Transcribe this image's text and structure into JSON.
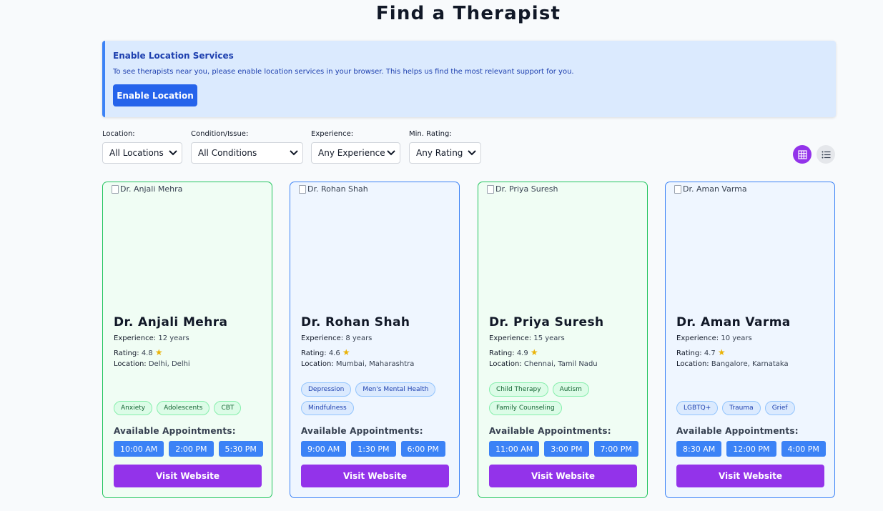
{
  "page": {
    "title": "Find a Therapist"
  },
  "banner": {
    "title": "Enable Location Services",
    "text": "To see therapists near you, please enable location services in your browser. This helps us find the most relevant support for you.",
    "button": "Enable Location"
  },
  "filters": [
    {
      "label": "Location:",
      "value": "All Locations"
    },
    {
      "label": "Condition/Issue:",
      "value": "All Conditions"
    },
    {
      "label": "Experience:",
      "value": "Any Experience"
    },
    {
      "label": "Min. Rating:",
      "value": "Any Rating"
    }
  ],
  "view_toggle": {
    "active": "grid",
    "colors": {
      "active": "#9333ea",
      "inactive": "#e5e7eb"
    }
  },
  "labels": {
    "experience": "Experience:",
    "rating": "Rating:",
    "location": "Location:",
    "appointments": "Available Appointments:",
    "visit": "Visit Website"
  },
  "therapists": [
    {
      "name": "Dr. Anjali Mehra",
      "image_alt": "Dr. Anjali Mehra",
      "theme": "green",
      "experience": "12 years",
      "rating": "4.8",
      "location": "Delhi, Delhi",
      "tags": [
        "Anxiety",
        "Adolescents",
        "CBT"
      ],
      "slots": [
        "10:00 AM",
        "2:00 PM",
        "5:30 PM"
      ]
    },
    {
      "name": "Dr. Rohan Shah",
      "image_alt": "Dr. Rohan Shah",
      "theme": "blue",
      "experience": "8 years",
      "rating": "4.6",
      "location": "Mumbai, Maharashtra",
      "tags": [
        "Depression",
        "Men's Mental Health",
        "Mindfulness"
      ],
      "slots": [
        "9:00 AM",
        "1:30 PM",
        "6:00 PM"
      ]
    },
    {
      "name": "Dr. Priya Suresh",
      "image_alt": "Dr. Priya Suresh",
      "theme": "green",
      "experience": "15 years",
      "rating": "4.9",
      "location": "Chennai, Tamil Nadu",
      "tags": [
        "Child Therapy",
        "Autism",
        "Family Counseling"
      ],
      "slots": [
        "11:00 AM",
        "3:00 PM",
        "7:00 PM"
      ]
    },
    {
      "name": "Dr. Aman Varma",
      "image_alt": "Dr. Aman Varma",
      "theme": "blue",
      "experience": "10 years",
      "rating": "4.7",
      "location": "Bangalore, Karnataka",
      "tags": [
        "LGBTQ+",
        "Trauma",
        "Grief"
      ],
      "slots": [
        "8:30 AM",
        "12:00 PM",
        "4:00 PM"
      ]
    }
  ],
  "colors": {
    "accent": "#9333ea",
    "primary": "#2563eb",
    "slot": "#3b82f6",
    "green_card": "#f0fdf4",
    "blue_card": "#eff6ff",
    "star": "#eab308"
  }
}
